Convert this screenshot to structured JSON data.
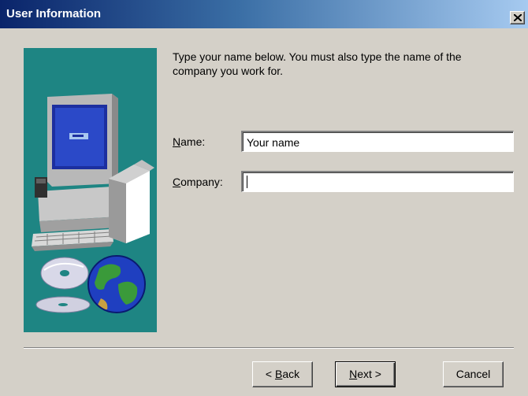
{
  "window": {
    "title": "User Information",
    "close_symbol": "×"
  },
  "illustration": {
    "icon": "computer-with-cd-and-globe",
    "background_color": "#1e8583"
  },
  "intro_text": "Type your name below. You must also type the name of the company you work for.",
  "form": {
    "name": {
      "label_mnemonic": "N",
      "label_rest": "ame:",
      "value": "Your name"
    },
    "company": {
      "label_mnemonic": "C",
      "label_rest": "ompany:",
      "value": ""
    }
  },
  "buttons": {
    "back": {
      "prefix": "< ",
      "mnemonic": "B",
      "rest": "ack"
    },
    "next": {
      "mnemonic": "N",
      "rest": "ext >"
    },
    "cancel": {
      "label": "Cancel"
    }
  },
  "colors": {
    "titlebar_start": "#0a246a",
    "titlebar_end": "#a6caf0",
    "dialog_face": "#d4d0c8"
  }
}
